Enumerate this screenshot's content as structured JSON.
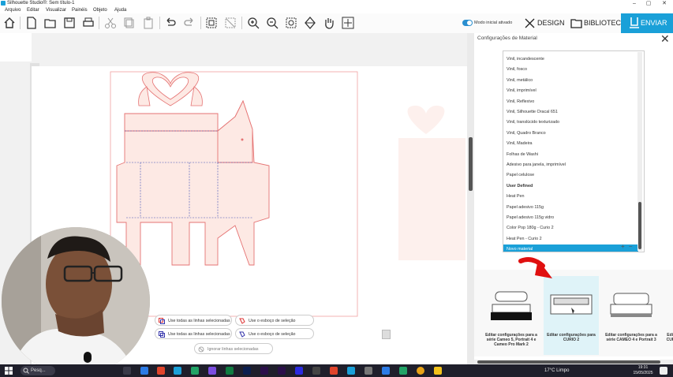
{
  "window": {
    "title": "Silhouette Studio®: Sem título-1",
    "minimize": "–",
    "maximize": "▢",
    "close": "✕"
  },
  "menu": [
    "Arquivo",
    "Editar",
    "Visualizar",
    "Painéis",
    "Objeto",
    "Ajuda"
  ],
  "toolbar": {
    "mode_label": "Modo inicial ativado",
    "design_label": "DESIGN",
    "library_label": "BIBLIOTECA",
    "send_label": "ENVIAR"
  },
  "panel": {
    "title": "Configurações de Material",
    "close": "✕",
    "materials": [
      "Vinil, incandescente",
      "Vinil, fosco",
      "Vinil, metálico",
      "Vinil, imprimível",
      "Vinil, Reflexivo",
      "Vinil, Silhouette Oracal 651",
      "Vinil, translúcido texturizado",
      "Vinil, Quadro Branco",
      "Vinil, Madeira",
      "Folhas de Washi",
      "Adesivo para janela, imprimível",
      "Papel celulose",
      "User Defined",
      "Heat Pen",
      "Papel adesivo 115g",
      "Papel adesivo 115g vidro",
      "Color Pop 180g - Curio 2",
      "Heat Pen - Curio 2",
      "Novo material"
    ],
    "selected_index": 18,
    "bold_index": 12,
    "add": "+",
    "remove": "−",
    "machines": [
      {
        "label": "Editar configurações para a série Cameo 5, Portrait 4 e Cameo Pro Mark 2"
      },
      {
        "label": "Editar configurações para CURIO 2"
      },
      {
        "label": "Editar configurações para a série CAMEO 4 e Portrait 3"
      },
      {
        "label": "Edit CUR"
      }
    ]
  },
  "popups": {
    "use_all_1": "Use todas as linhas selecionadas",
    "use_edge_1": "Use o esboço de seleção",
    "use_all_2": "Use todas as linhas selecionadas",
    "use_edge_2": "Use o esboço de seleção",
    "ignore": "Ignorar linhas selecionadas"
  },
  "taskbar": {
    "search": "Pesq...",
    "weather": "17°C  Limpo",
    "time": "19:31",
    "date": "15/05/2025"
  },
  "colors": {
    "accent": "#1aa0d8",
    "cut_line": "#e57373",
    "fill": "#fde9e4",
    "fold_line": "#3f51b5"
  }
}
